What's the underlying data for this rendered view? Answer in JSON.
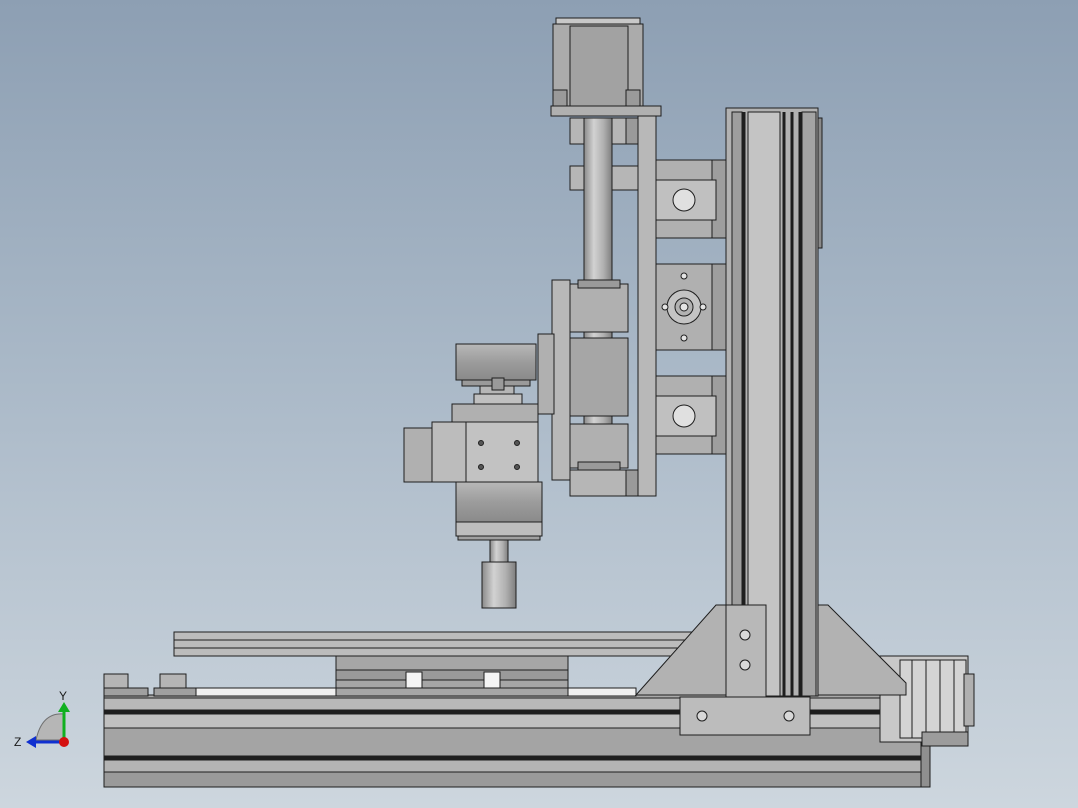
{
  "triad": {
    "y_label": "Y",
    "z_label": "Z",
    "x_axis_color": "#d41010",
    "y_axis_color": "#10b020",
    "z_axis_color": "#1030d0"
  },
  "colors": {
    "background_top": "#8d9fb3",
    "background_bottom": "#cdd6de",
    "part_fill": "#a8a8a8",
    "part_light": "#c4c4c4",
    "part_dark": "#8e8e8e",
    "edge": "#1e1e1e"
  }
}
